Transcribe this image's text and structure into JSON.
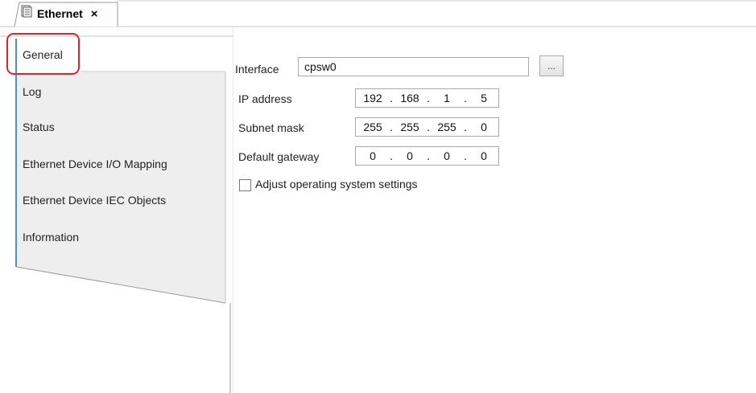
{
  "tab": {
    "title": "Ethernet",
    "close": "×"
  },
  "sidebar": {
    "items": [
      {
        "label": "General"
      },
      {
        "label": "Log"
      },
      {
        "label": "Status"
      },
      {
        "label": "Ethernet Device I/O Mapping"
      },
      {
        "label": "Ethernet Device IEC Objects"
      },
      {
        "label": "Information"
      }
    ]
  },
  "general": {
    "interface_label": "Interface",
    "interface_value": "cpsw0",
    "browse_label": "...",
    "ip_label": "IP address",
    "ip": [
      "192",
      "168",
      "1",
      "5"
    ],
    "subnet_label": "Subnet mask",
    "subnet": [
      "255",
      "255",
      "255",
      "0"
    ],
    "gateway_label": "Default gateway",
    "gateway": [
      "0",
      "0",
      "0",
      "0"
    ],
    "adjust_label": "Adjust operating system settings"
  },
  "colors": {
    "highlight": "#e0242b",
    "tab_accent": "#4a90d9"
  }
}
